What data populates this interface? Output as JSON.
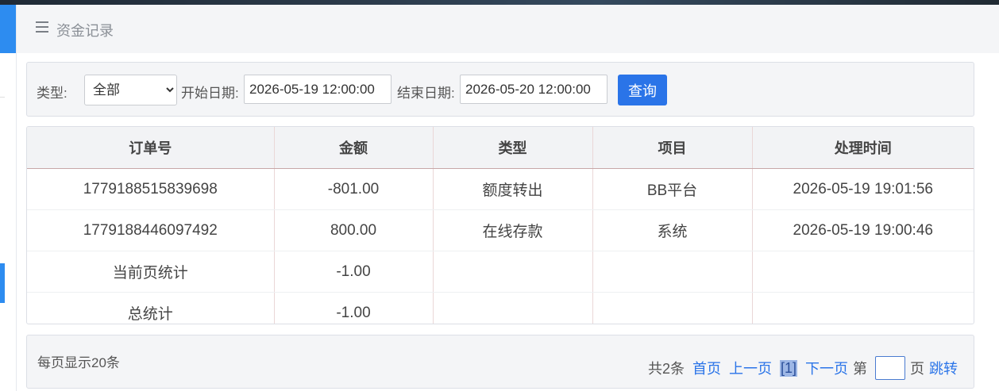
{
  "page": {
    "title": "资金记录"
  },
  "filter": {
    "type_label": "类型:",
    "type_selected": "全部",
    "start_label": "开始日期:",
    "start_value": "2026-05-19 12:00:00",
    "end_label": "结束日期:",
    "end_value": "2026-05-20 12:00:00",
    "query_label": "查询"
  },
  "table": {
    "headers": [
      "订单号",
      "金额",
      "类型",
      "项目",
      "处理时间"
    ],
    "rows": [
      [
        "1779188515839698",
        "-801.00",
        "额度转出",
        "BB平台",
        "2026-05-19 19:01:56"
      ],
      [
        "1779188446097492",
        "800.00",
        "在线存款",
        "系统",
        "2026-05-19 19:00:46"
      ],
      [
        "当前页统计",
        "-1.00",
        "",
        "",
        ""
      ],
      [
        "总统计",
        "-1.00",
        "",
        "",
        ""
      ]
    ]
  },
  "pager": {
    "per_page": "每页显示20条",
    "total": "共2条",
    "first": "首页",
    "prev": "上一页",
    "current": "[1]",
    "next": "下一页",
    "goto_prefix": "第",
    "goto_suffix": "页",
    "jump": "跳转"
  },
  "colors": {
    "accent": "#2a74e8",
    "sidebar_accent": "#2d8cf0"
  }
}
